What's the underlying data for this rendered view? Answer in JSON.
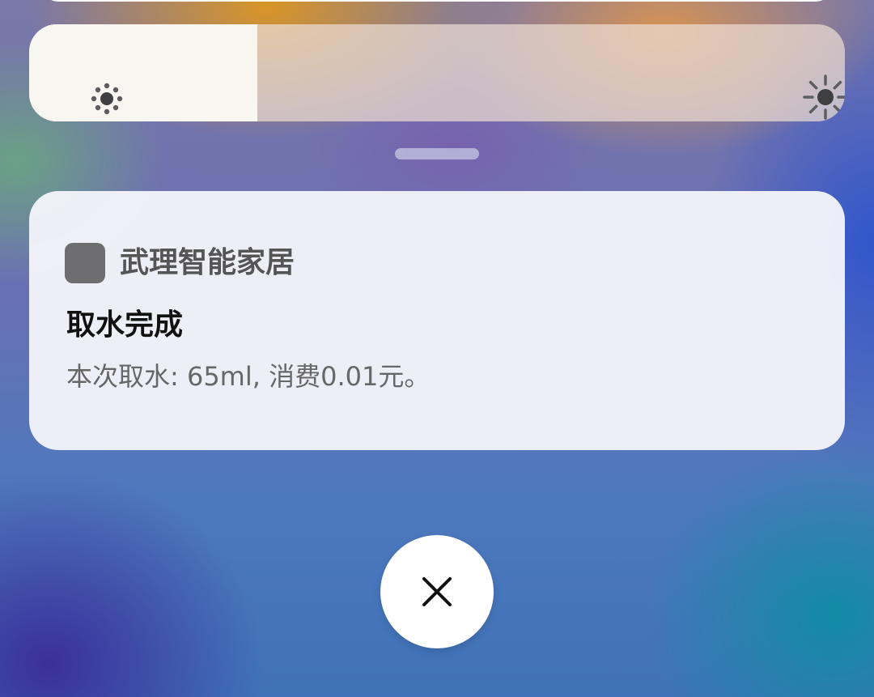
{
  "brightness": {
    "level_percent": 28,
    "min_icon": "sun-dim-icon",
    "max_icon": "sun-bright-icon"
  },
  "notification": {
    "app_name": "武理智能家居",
    "title": "取水完成",
    "body": "本次取水: 65ml, 消费0.01元。",
    "app_icon": "app-icon"
  },
  "dismiss": {
    "icon": "close-icon"
  },
  "colors": {
    "card_bg": "#f4f4fa",
    "icon_gray": "#6e6e70",
    "title_text": "#111111",
    "body_text": "#676769"
  }
}
